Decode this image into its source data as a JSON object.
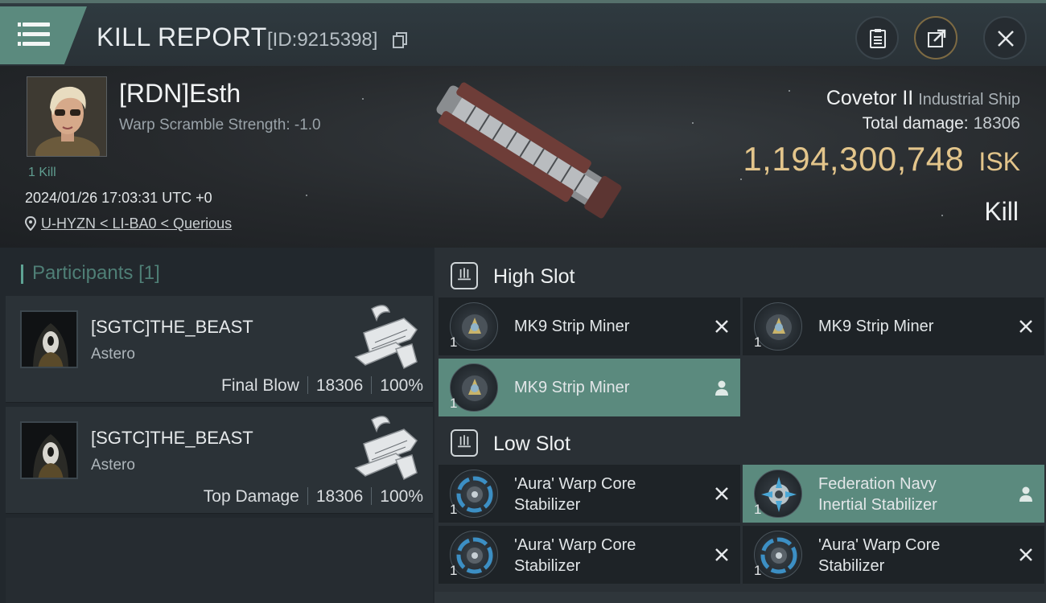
{
  "header": {
    "title": "KILL REPORT",
    "report_id": "[ID:9215398]"
  },
  "victim": {
    "name": "[RDN]Esth",
    "warp_scramble": "Warp Scramble Strength: -1.0",
    "kill_count": "1 Kill",
    "timestamp": "2024/01/26 17:03:31 UTC +0",
    "location": "U-HYZN < LI-BA0 < Querious",
    "ship_name": "Covetor II",
    "ship_class": "Industrial Ship",
    "damage_label": "Total damage:",
    "damage_value": "18306",
    "isk_value": "1,194,300,748",
    "isk_unit": "ISK",
    "outcome": "Kill"
  },
  "participants": {
    "title": "Participants",
    "count": "[1]",
    "items": [
      {
        "name": "[SGTC]THE_BEAST",
        "ship": "Astero",
        "role": "Final Blow",
        "damage": "18306",
        "percent": "100%"
      },
      {
        "name": "[SGTC]THE_BEAST",
        "ship": "Astero",
        "role": "Top Damage",
        "damage": "18306",
        "percent": "100%"
      }
    ]
  },
  "slots": {
    "high": {
      "label": "High Slot",
      "modules": [
        {
          "name": "MK9 Strip Miner",
          "qty": "1",
          "status": "destroyed"
        },
        {
          "name": "MK9 Strip Miner",
          "qty": "1",
          "status": "destroyed"
        },
        {
          "name": "MK9 Strip Miner",
          "qty": "1",
          "status": "dropped"
        }
      ]
    },
    "low": {
      "label": "Low Slot",
      "modules": [
        {
          "name_line1": "'Aura' Warp Core",
          "name_line2": "Stabilizer",
          "qty": "1",
          "status": "destroyed"
        },
        {
          "name_line1": "Federation Navy",
          "name_line2": "Inertial Stabilizer",
          "qty": "1",
          "status": "dropped"
        },
        {
          "name_line1": "'Aura' Warp Core",
          "name_line2": "Stabilizer",
          "qty": "1",
          "status": "destroyed"
        },
        {
          "name_line1": "'Aura' Warp Core",
          "name_line2": "Stabilizer",
          "qty": "1",
          "status": "destroyed"
        }
      ]
    }
  },
  "colors": {
    "accent": "#5b8a7e",
    "isk": "#e3c58b",
    "background": "#1b1f24"
  },
  "icons": {
    "menu": "menu-icon",
    "copy": "copy-icon",
    "report": "clipboard-icon",
    "share": "share-icon",
    "close": "close-icon",
    "location": "location-pin-icon",
    "destroyed": "close-icon",
    "dropped": "person-icon"
  }
}
